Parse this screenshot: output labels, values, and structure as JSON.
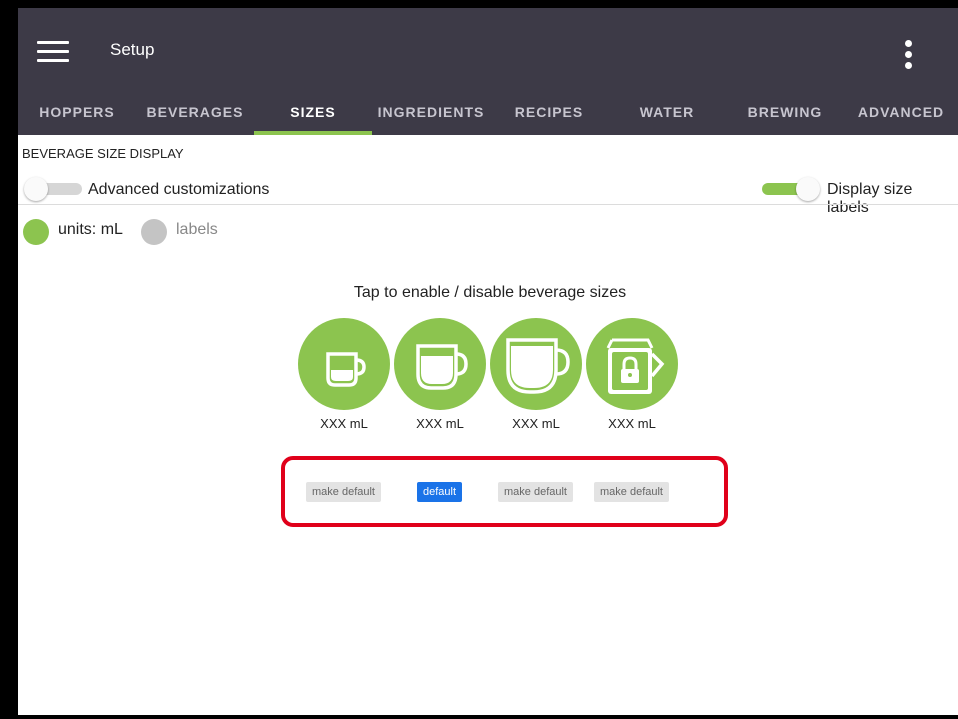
{
  "header": {
    "title": "Setup",
    "tabs": [
      {
        "label": "HOPPERS",
        "active": false
      },
      {
        "label": "BEVERAGES",
        "active": false
      },
      {
        "label": "SIZES",
        "active": true
      },
      {
        "label": "INGREDIENTS",
        "active": false
      },
      {
        "label": "RECIPES",
        "active": false
      },
      {
        "label": "WATER",
        "active": false
      },
      {
        "label": "BREWING",
        "active": false
      },
      {
        "label": "ADVANCED",
        "active": false
      }
    ]
  },
  "section": {
    "title": "BEVERAGE SIZE DISPLAY",
    "advanced_toggle": {
      "label": "Advanced customizations",
      "on": false
    },
    "labels_toggle": {
      "label": "Display size labels",
      "on": true
    },
    "radios": [
      {
        "label": "units: mL",
        "selected": true
      },
      {
        "label": "labels",
        "selected": false
      }
    ]
  },
  "sizes": {
    "instruction": "Tap to enable / disable beverage sizes",
    "items": [
      {
        "icon": "small-cup-icon",
        "label": "XXX mL",
        "button": "make default",
        "is_default": false
      },
      {
        "icon": "medium-cup-icon",
        "label": "XXX mL",
        "button": "default",
        "is_default": true
      },
      {
        "icon": "large-cup-icon",
        "label": "XXX mL",
        "button": "make default",
        "is_default": false
      },
      {
        "icon": "locked-carafe-icon",
        "label": "XXX mL",
        "button": "make default",
        "is_default": false
      }
    ]
  },
  "colors": {
    "header_bg": "#3d3a47",
    "accent_green": "#8cc44f",
    "default_blue": "#1a73e8",
    "highlight_red": "#e0001a"
  }
}
